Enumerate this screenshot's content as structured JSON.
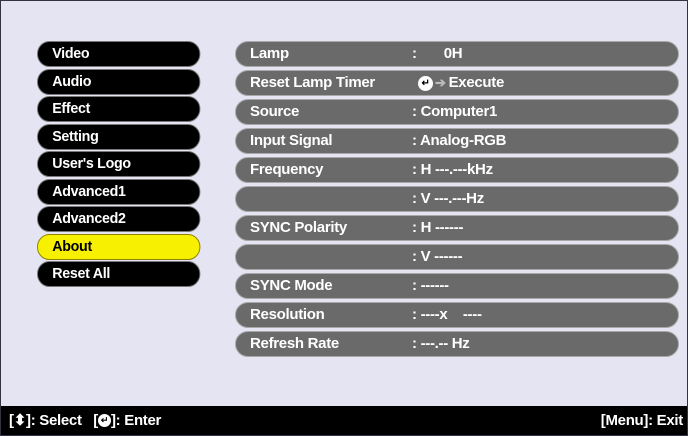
{
  "menu": {
    "items": [
      {
        "label": "Video"
      },
      {
        "label": "Audio"
      },
      {
        "label": "Effect"
      },
      {
        "label": "Setting"
      },
      {
        "label": "User's Logo"
      },
      {
        "label": "Advanced1"
      },
      {
        "label": "Advanced2"
      },
      {
        "label": "About",
        "active": true
      },
      {
        "label": "Reset All"
      }
    ]
  },
  "about": {
    "lamp_label": "Lamp",
    "lamp_value": ":       0H",
    "reset_lamp_label": "Reset Lamp Timer",
    "reset_lamp_action": "Execute",
    "source_label": "Source",
    "source_value": ": Computer1",
    "input_signal_label": "Input Signal",
    "input_signal_value": ": Analog-RGB",
    "frequency_label": "Frequency",
    "frequency_h": ": H ---.---kHz",
    "frequency_v": ": V ---.---Hz",
    "sync_polarity_label": "SYNC Polarity",
    "sync_polarity_h": ": H ------",
    "sync_polarity_v": ": V ------",
    "sync_mode_label": "SYNC Mode",
    "sync_mode_value": ": ------",
    "resolution_label": "Resolution",
    "resolution_value": ": ----x    ----",
    "refresh_rate_label": "Refresh Rate",
    "refresh_rate_value": ": ---.-- Hz"
  },
  "footer": {
    "select_hint": ": Select",
    "enter_hint": ": Enter",
    "exit_hint": "[Menu]: Exit"
  }
}
